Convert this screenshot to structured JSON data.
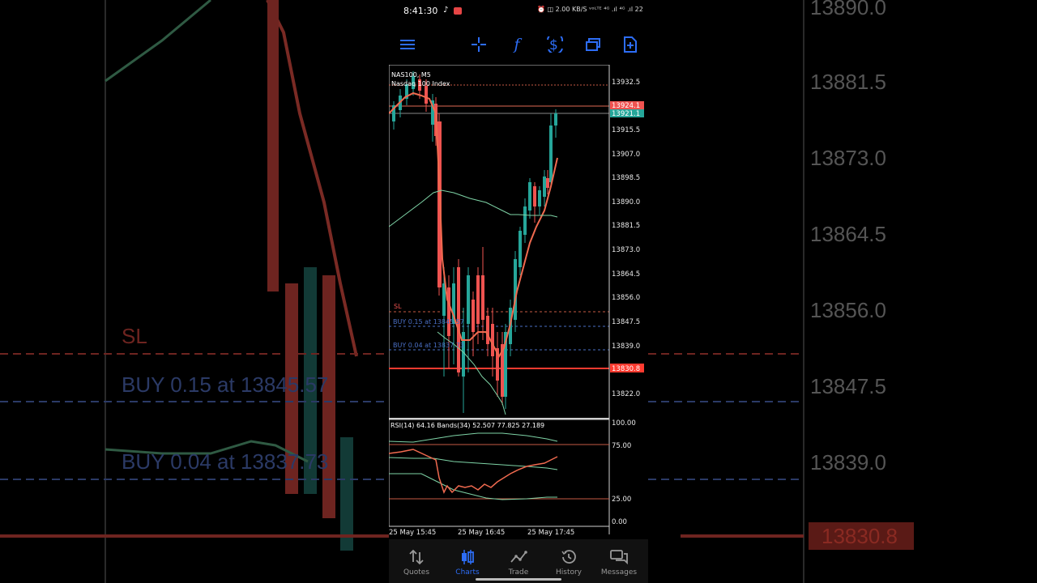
{
  "status_bar": {
    "time": "8:41:30",
    "right_indicators": "⏰ ◫ 2.00 KB/S ᵛᵒᴸᵀᴱ ⁴ᴳ .ıl ⁴ᴳ .ıl 22"
  },
  "toolbar": {
    "icons": [
      "menu-icon",
      "crosshair-icon",
      "indicators-icon",
      "symbols-icon",
      "windows-icon",
      "new-order-icon"
    ]
  },
  "chart": {
    "symbol": "NAS100, M5",
    "description": "Nasdaq 100 Index",
    "ask_price": "13924.1",
    "bid_price": "13921.1",
    "sl_price": "13830.8",
    "sl_label": "SL",
    "order1": "BUY 0.15 at 13845.57",
    "order2": "BUY 0.04 at 13837.73",
    "y_ticks": [
      "13932.5",
      "13915.5",
      "13907.0",
      "13898.5",
      "13890.0",
      "13881.5",
      "13873.0",
      "13864.5",
      "13856.0",
      "13847.5",
      "13839.0",
      "13822.0"
    ],
    "x_ticks": [
      "25 May 15:45",
      "25 May 16:45",
      "25 May 17:45"
    ],
    "colors": {
      "bull": "#26a69a",
      "bear": "#ef5350",
      "ma": "#f06a4f",
      "bands": "#7ed3a6",
      "order": "#4a6fc4",
      "sl": "#ff3b30"
    }
  },
  "rsi": {
    "label": "RSI(14) 64.16 Bands(34) 52.507 77.825 27.189",
    "levels": [
      "100.00",
      "75.00",
      "25.00",
      "0.00"
    ]
  },
  "background": {
    "prices_right": [
      "13890.0",
      "13881.5",
      "13873.0",
      "13864.5",
      "13856.0",
      "13847.5",
      "13839.0"
    ],
    "sl_price": "13830.8",
    "sl_label": "SL",
    "order1": "BUY 0.15 at 13845.57",
    "order2": "BUY 0.04 at 13837.73"
  },
  "bottom_nav": [
    {
      "label": "Quotes",
      "icon": "quotes-icon",
      "active": false
    },
    {
      "label": "Charts",
      "icon": "charts-icon",
      "active": true
    },
    {
      "label": "Trade",
      "icon": "trade-icon",
      "active": false
    },
    {
      "label": "History",
      "icon": "history-icon",
      "active": false
    },
    {
      "label": "Messages",
      "icon": "messages-icon",
      "active": false
    }
  ]
}
